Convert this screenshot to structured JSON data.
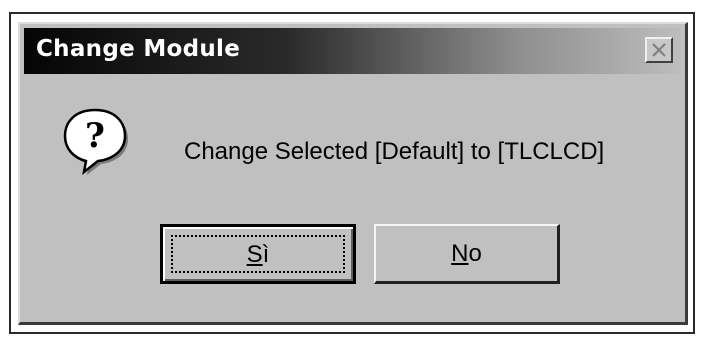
{
  "dialog": {
    "title": "Change Module",
    "message": "Change Selected [Default] to [TLCLCD]",
    "icon": "question-icon",
    "close_icon": "close-icon"
  },
  "buttons": {
    "yes_mnemonic": "S",
    "yes_rest": "ì",
    "no_mnemonic": "N",
    "no_rest": "o"
  }
}
